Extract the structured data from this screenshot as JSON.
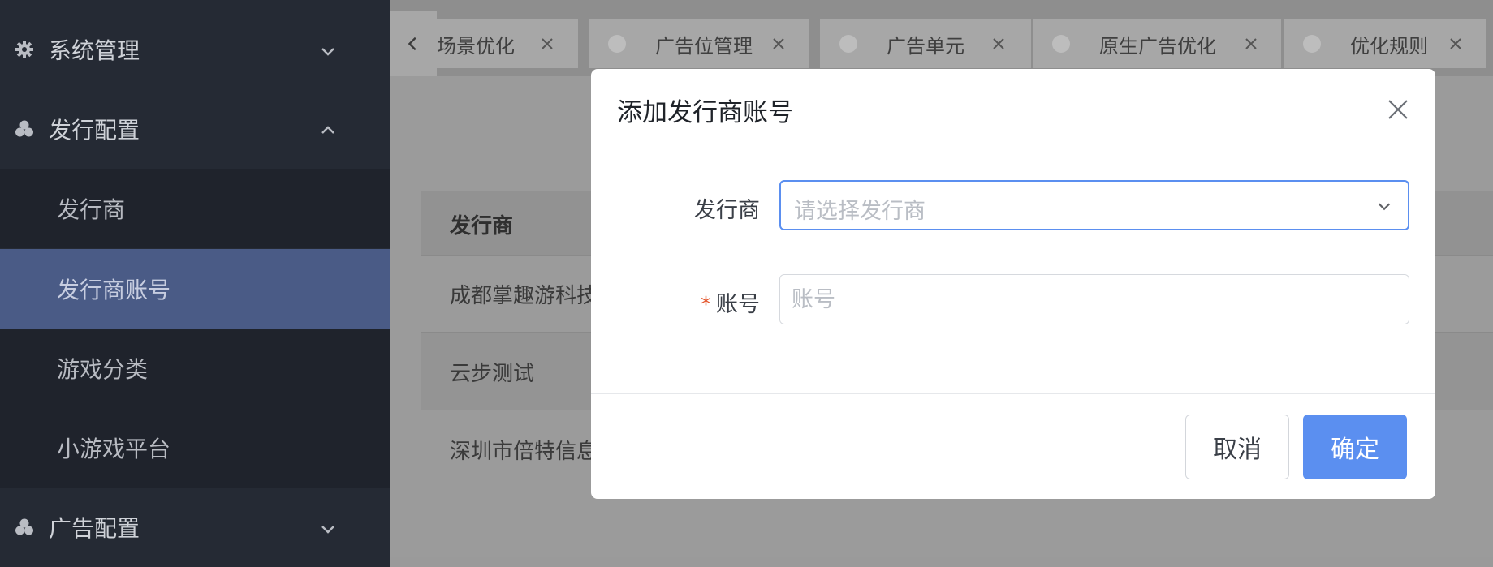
{
  "sidebar": {
    "groups": [
      {
        "label": "系统管理",
        "icon": "gear-icon",
        "expanded": false
      },
      {
        "label": "发行配置",
        "icon": "cluster-icon",
        "expanded": true
      },
      {
        "label": "广告配置",
        "icon": "cluster-icon",
        "expanded": false
      }
    ],
    "sub_items": [
      {
        "label": "发行商",
        "active": false
      },
      {
        "label": "发行商账号",
        "active": true
      },
      {
        "label": "游戏分类",
        "active": false
      },
      {
        "label": "小游戏平台",
        "active": false
      }
    ]
  },
  "tabs": [
    {
      "label": "场景优化"
    },
    {
      "label": "广告位管理"
    },
    {
      "label": "广告单元"
    },
    {
      "label": "原生广告优化"
    },
    {
      "label": "优化规则"
    }
  ],
  "table": {
    "header": "发行商",
    "rows": [
      "成都掌趣游科技",
      "云步测试",
      "深圳市倍特信息"
    ]
  },
  "modal": {
    "title": "添加发行商账号",
    "publisher": {
      "label": "发行商",
      "placeholder": "请选择发行商",
      "value": ""
    },
    "account": {
      "required_mark": "*",
      "label": "账号",
      "placeholder": "账号",
      "value": ""
    },
    "cancel_label": "取消",
    "confirm_label": "确定"
  },
  "colors": {
    "primary": "#5b8ff0",
    "sidebar_bg": "#252a34",
    "sidebar_active": "#4a5b86",
    "required": "#e4572e"
  }
}
